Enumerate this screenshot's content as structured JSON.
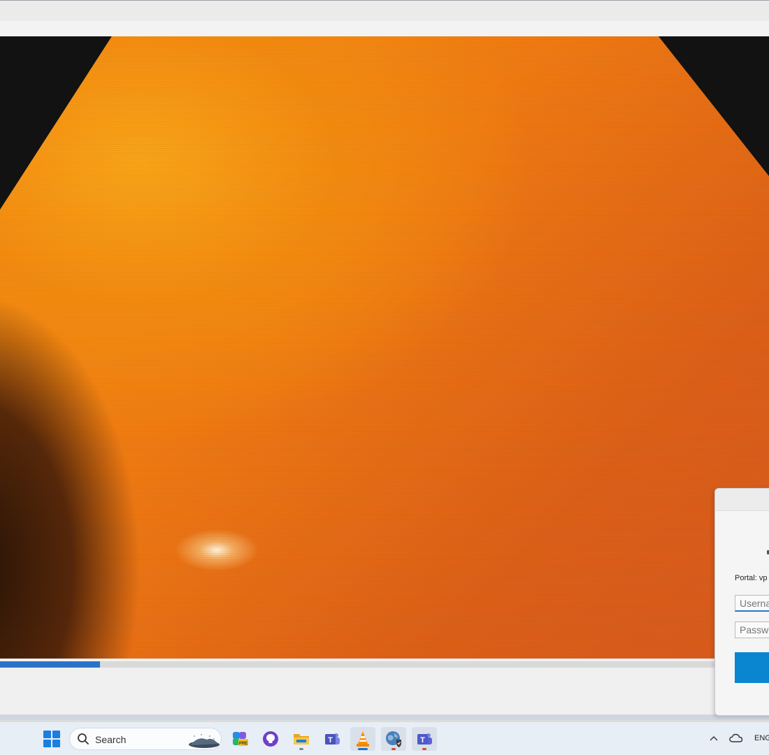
{
  "player": {
    "progress_percent": 13
  },
  "vpn_dialog": {
    "portal_label": "Portal: vp",
    "username_placeholder": "Userna",
    "password_placeholder": "Passwo"
  },
  "taskbar": {
    "search_label": "Search",
    "apps": [
      {
        "name": "copilot-pre-icon",
        "state": "none"
      },
      {
        "name": "github-desktop-icon",
        "state": "none"
      },
      {
        "name": "file-explorer-icon",
        "state": "running"
      },
      {
        "name": "teams-classic-icon",
        "state": "none"
      },
      {
        "name": "vlc-icon",
        "state": "active"
      },
      {
        "name": "vpn-globe-icon",
        "state": "alert"
      },
      {
        "name": "teams-icon",
        "state": "alert"
      }
    ],
    "tray": {
      "language": "ENG"
    }
  },
  "colors": {
    "accent": "#2a73c9",
    "connect_button": "#0a85d0",
    "video_orange": "#ef7a12"
  }
}
